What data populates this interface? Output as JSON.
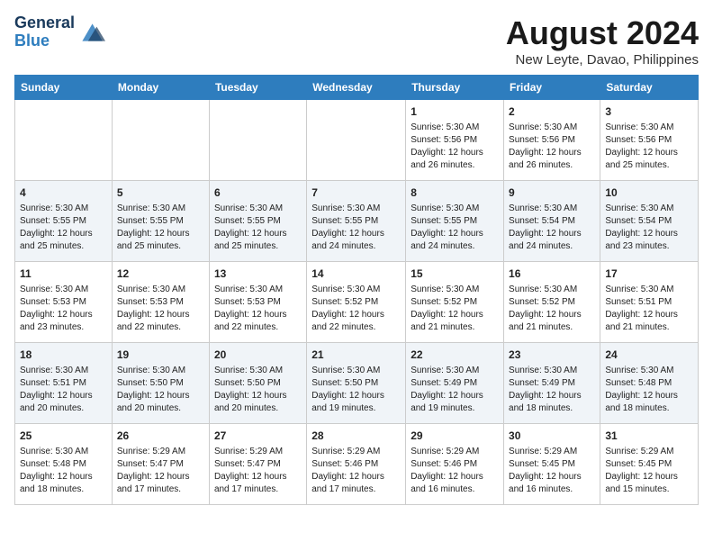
{
  "header": {
    "logo_line1": "General",
    "logo_line2": "Blue",
    "month_year": "August 2024",
    "location": "New Leyte, Davao, Philippines"
  },
  "days_of_week": [
    "Sunday",
    "Monday",
    "Tuesday",
    "Wednesday",
    "Thursday",
    "Friday",
    "Saturday"
  ],
  "weeks": [
    [
      {
        "day": "",
        "detail": ""
      },
      {
        "day": "",
        "detail": ""
      },
      {
        "day": "",
        "detail": ""
      },
      {
        "day": "",
        "detail": ""
      },
      {
        "day": "1",
        "detail": "Sunrise: 5:30 AM\nSunset: 5:56 PM\nDaylight: 12 hours\nand 26 minutes."
      },
      {
        "day": "2",
        "detail": "Sunrise: 5:30 AM\nSunset: 5:56 PM\nDaylight: 12 hours\nand 26 minutes."
      },
      {
        "day": "3",
        "detail": "Sunrise: 5:30 AM\nSunset: 5:56 PM\nDaylight: 12 hours\nand 25 minutes."
      }
    ],
    [
      {
        "day": "4",
        "detail": "Sunrise: 5:30 AM\nSunset: 5:55 PM\nDaylight: 12 hours\nand 25 minutes."
      },
      {
        "day": "5",
        "detail": "Sunrise: 5:30 AM\nSunset: 5:55 PM\nDaylight: 12 hours\nand 25 minutes."
      },
      {
        "day": "6",
        "detail": "Sunrise: 5:30 AM\nSunset: 5:55 PM\nDaylight: 12 hours\nand 25 minutes."
      },
      {
        "day": "7",
        "detail": "Sunrise: 5:30 AM\nSunset: 5:55 PM\nDaylight: 12 hours\nand 24 minutes."
      },
      {
        "day": "8",
        "detail": "Sunrise: 5:30 AM\nSunset: 5:55 PM\nDaylight: 12 hours\nand 24 minutes."
      },
      {
        "day": "9",
        "detail": "Sunrise: 5:30 AM\nSunset: 5:54 PM\nDaylight: 12 hours\nand 24 minutes."
      },
      {
        "day": "10",
        "detail": "Sunrise: 5:30 AM\nSunset: 5:54 PM\nDaylight: 12 hours\nand 23 minutes."
      }
    ],
    [
      {
        "day": "11",
        "detail": "Sunrise: 5:30 AM\nSunset: 5:53 PM\nDaylight: 12 hours\nand 23 minutes."
      },
      {
        "day": "12",
        "detail": "Sunrise: 5:30 AM\nSunset: 5:53 PM\nDaylight: 12 hours\nand 22 minutes."
      },
      {
        "day": "13",
        "detail": "Sunrise: 5:30 AM\nSunset: 5:53 PM\nDaylight: 12 hours\nand 22 minutes."
      },
      {
        "day": "14",
        "detail": "Sunrise: 5:30 AM\nSunset: 5:52 PM\nDaylight: 12 hours\nand 22 minutes."
      },
      {
        "day": "15",
        "detail": "Sunrise: 5:30 AM\nSunset: 5:52 PM\nDaylight: 12 hours\nand 21 minutes."
      },
      {
        "day": "16",
        "detail": "Sunrise: 5:30 AM\nSunset: 5:52 PM\nDaylight: 12 hours\nand 21 minutes."
      },
      {
        "day": "17",
        "detail": "Sunrise: 5:30 AM\nSunset: 5:51 PM\nDaylight: 12 hours\nand 21 minutes."
      }
    ],
    [
      {
        "day": "18",
        "detail": "Sunrise: 5:30 AM\nSunset: 5:51 PM\nDaylight: 12 hours\nand 20 minutes."
      },
      {
        "day": "19",
        "detail": "Sunrise: 5:30 AM\nSunset: 5:50 PM\nDaylight: 12 hours\nand 20 minutes."
      },
      {
        "day": "20",
        "detail": "Sunrise: 5:30 AM\nSunset: 5:50 PM\nDaylight: 12 hours\nand 20 minutes."
      },
      {
        "day": "21",
        "detail": "Sunrise: 5:30 AM\nSunset: 5:50 PM\nDaylight: 12 hours\nand 19 minutes."
      },
      {
        "day": "22",
        "detail": "Sunrise: 5:30 AM\nSunset: 5:49 PM\nDaylight: 12 hours\nand 19 minutes."
      },
      {
        "day": "23",
        "detail": "Sunrise: 5:30 AM\nSunset: 5:49 PM\nDaylight: 12 hours\nand 18 minutes."
      },
      {
        "day": "24",
        "detail": "Sunrise: 5:30 AM\nSunset: 5:48 PM\nDaylight: 12 hours\nand 18 minutes."
      }
    ],
    [
      {
        "day": "25",
        "detail": "Sunrise: 5:30 AM\nSunset: 5:48 PM\nDaylight: 12 hours\nand 18 minutes."
      },
      {
        "day": "26",
        "detail": "Sunrise: 5:29 AM\nSunset: 5:47 PM\nDaylight: 12 hours\nand 17 minutes."
      },
      {
        "day": "27",
        "detail": "Sunrise: 5:29 AM\nSunset: 5:47 PM\nDaylight: 12 hours\nand 17 minutes."
      },
      {
        "day": "28",
        "detail": "Sunrise: 5:29 AM\nSunset: 5:46 PM\nDaylight: 12 hours\nand 17 minutes."
      },
      {
        "day": "29",
        "detail": "Sunrise: 5:29 AM\nSunset: 5:46 PM\nDaylight: 12 hours\nand 16 minutes."
      },
      {
        "day": "30",
        "detail": "Sunrise: 5:29 AM\nSunset: 5:45 PM\nDaylight: 12 hours\nand 16 minutes."
      },
      {
        "day": "31",
        "detail": "Sunrise: 5:29 AM\nSunset: 5:45 PM\nDaylight: 12 hours\nand 15 minutes."
      }
    ]
  ]
}
